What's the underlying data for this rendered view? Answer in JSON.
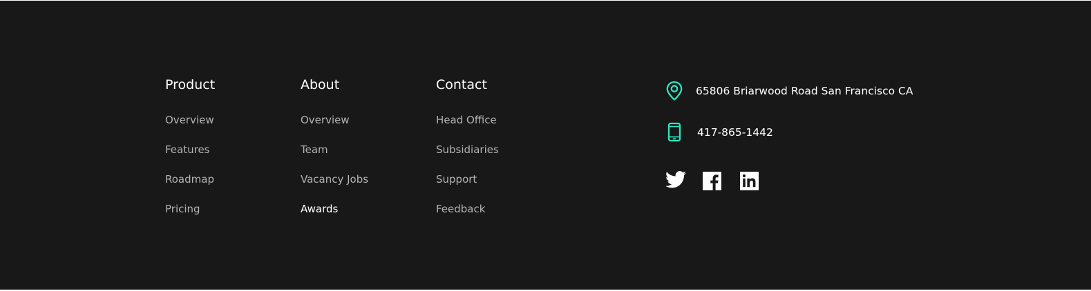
{
  "footer": {
    "columns": [
      {
        "title": "Product",
        "links": [
          {
            "label": "Overview",
            "active": false
          },
          {
            "label": "Features",
            "active": false
          },
          {
            "label": "Roadmap",
            "active": false
          },
          {
            "label": "Pricing",
            "active": false
          }
        ]
      },
      {
        "title": "About",
        "links": [
          {
            "label": "Overview",
            "active": false
          },
          {
            "label": "Team",
            "active": false
          },
          {
            "label": "Vacancy Jobs",
            "active": false
          },
          {
            "label": "Awards",
            "active": true
          }
        ]
      },
      {
        "title": "Contact",
        "links": [
          {
            "label": "Head Office",
            "active": false
          },
          {
            "label": "Subsidiaries",
            "active": false
          },
          {
            "label": "Support",
            "active": false
          },
          {
            "label": "Feedback",
            "active": false
          }
        ]
      }
    ],
    "address": "65806 Briarwood Road San Francisco CA",
    "phone": "417-865-1442",
    "icons": {
      "address": "map-pin-icon",
      "phone": "smartphone-icon"
    },
    "social": [
      "twitter-icon",
      "facebook-icon",
      "linkedin-icon"
    ],
    "colors": {
      "background": "#181818",
      "accent": "#2ee6c0",
      "heading": "#ffffff",
      "link": "#b3b3b3",
      "link_active": "#ffffff"
    }
  }
}
